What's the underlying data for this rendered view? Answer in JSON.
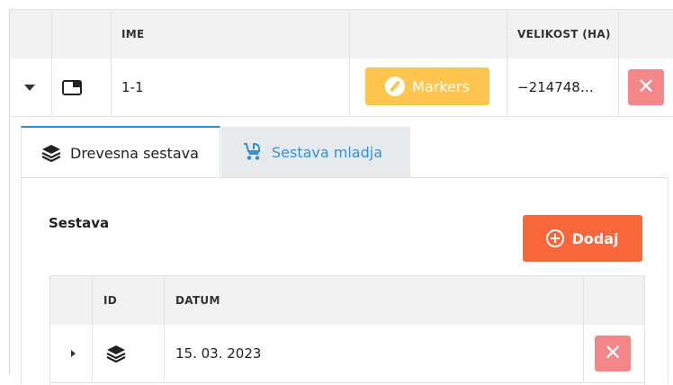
{
  "main_table": {
    "headers": {
      "ime": "IME",
      "velikost": "VELIKOST (HA)"
    },
    "row": {
      "name": "1-1",
      "markers_label": "Markers",
      "size": "−214748…",
      "delete_label": "✕"
    }
  },
  "tabs": [
    {
      "label": "Drevesna sestava",
      "icon": "layers-icon",
      "active": true
    },
    {
      "label": "Sestava mladja",
      "icon": "stroller-icon",
      "active": false
    }
  ],
  "section": {
    "title": "Sestava",
    "add_label": "Dodaj",
    "table": {
      "headers": {
        "id": "ID",
        "datum": "DATUM"
      },
      "row": {
        "date": "15. 03. 2023",
        "delete_label": "✕"
      }
    }
  },
  "colors": {
    "markers_button": "#fdc54e",
    "delete_button": "#f58688",
    "add_button": "#f8663c",
    "active_tab_border": "#2f8fd6",
    "inactive_tab_text": "#3a8fcf"
  }
}
